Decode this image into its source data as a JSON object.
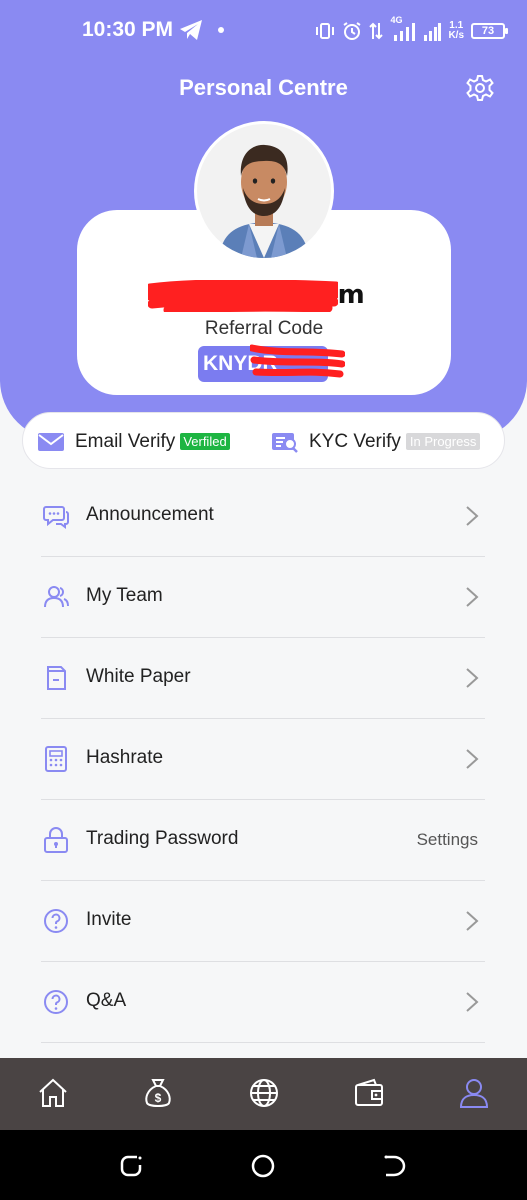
{
  "status_bar": {
    "time": "10:30 PM",
    "network_type": "4G",
    "net_speed_value": "1.1",
    "net_speed_unit": "K/s",
    "battery": "73"
  },
  "header": {
    "title": "Personal Centre",
    "settings_icon": "gear-icon"
  },
  "profile": {
    "email": "Haru              mail.com",
    "referral_label": "Referral Code",
    "referral_code": "KNYDR"
  },
  "verify": {
    "email_label": "Email Verify",
    "email_status": "Verfiled",
    "kyc_label": "KYC Verify",
    "kyc_status": "In Progress",
    "status_colors": {
      "verified": "#1db542",
      "in_progress": "#d8d8da"
    }
  },
  "menu": [
    {
      "label": "Announcement",
      "icon": "chat-bubbles-icon"
    },
    {
      "label": "My Team",
      "icon": "team-icon"
    },
    {
      "label": "White Paper",
      "icon": "document-icon"
    },
    {
      "label": "Hashrate",
      "icon": "calculator-icon"
    },
    {
      "label": "Trading Password",
      "icon": "lock-icon",
      "value": "Settings"
    },
    {
      "label": "Invite",
      "icon": "question-circle-icon"
    },
    {
      "label": "Q&A",
      "icon": "question-circle-icon"
    }
  ],
  "bottom_nav": [
    {
      "icon": "home-icon"
    },
    {
      "icon": "money-bag-icon"
    },
    {
      "icon": "globe-icon"
    },
    {
      "icon": "wallet-icon"
    },
    {
      "icon": "profile-icon",
      "active": true
    }
  ],
  "colors": {
    "accent": "#8a8af2",
    "nav_background": "#4a4444",
    "active_tab": "#8a8af2"
  }
}
